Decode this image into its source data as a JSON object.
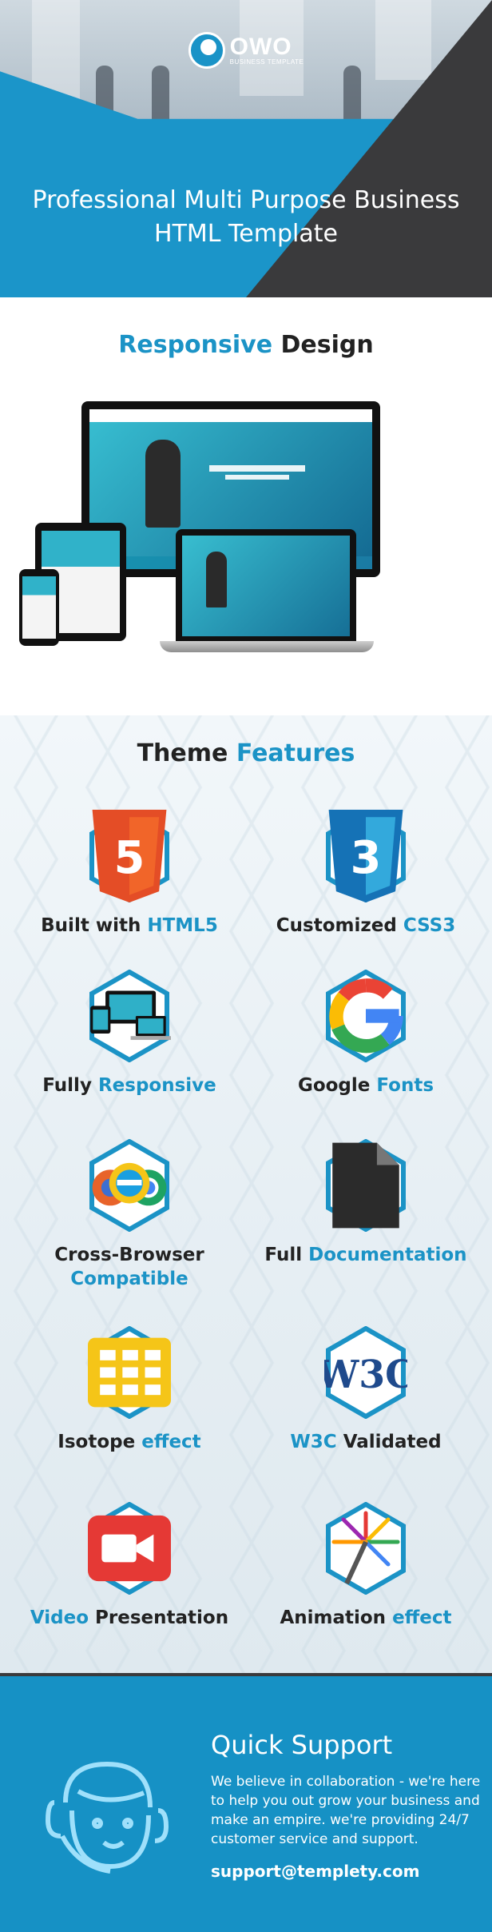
{
  "hero": {
    "logo_name": "OWO",
    "logo_sub": "BUSINESS TEMPLATE",
    "headline_line1": "Professional Multi Purpose Business",
    "headline_line2": "HTML Template"
  },
  "responsive": {
    "title_accent": "Responsive",
    "title_rest": " Design"
  },
  "features": {
    "title_plain": "Theme ",
    "title_accent": "Features",
    "items": [
      {
        "plain": "Built with ",
        "accent": "HTML5",
        "icon": "html5-icon"
      },
      {
        "plain": "Customized ",
        "accent": "CSS3",
        "icon": "css3-icon"
      },
      {
        "plain": "Fully ",
        "accent": "Responsive",
        "icon": "devices-icon"
      },
      {
        "plain": "Google ",
        "accent": "Fonts",
        "icon": "google-icon"
      },
      {
        "plain": "Cross-Browser",
        "accent": "Compatible",
        "icon": "browsers-icon"
      },
      {
        "plain": "Full ",
        "accent": "Documentation",
        "icon": "document-icon"
      },
      {
        "plain": "Isotope ",
        "accent": "effect",
        "icon": "grid-icon"
      },
      {
        "accent": "W3C",
        "plain": " Validated",
        "icon": "w3c-icon"
      },
      {
        "accent": "Video",
        "plain": " Presentation",
        "icon": "video-camera-icon"
      },
      {
        "plain": "Animation ",
        "accent": "effect",
        "icon": "firework-icon"
      }
    ]
  },
  "support": {
    "title": "Quick Support",
    "body": "We believe in collaboration - we're here to help you out grow your business and make an empire. we're providing 24/7 customer service and support.",
    "email": "support@templety.com"
  },
  "colors": {
    "accent": "#1b93c6",
    "dark": "#3a3a3c",
    "support_bg": "#1691c5"
  }
}
